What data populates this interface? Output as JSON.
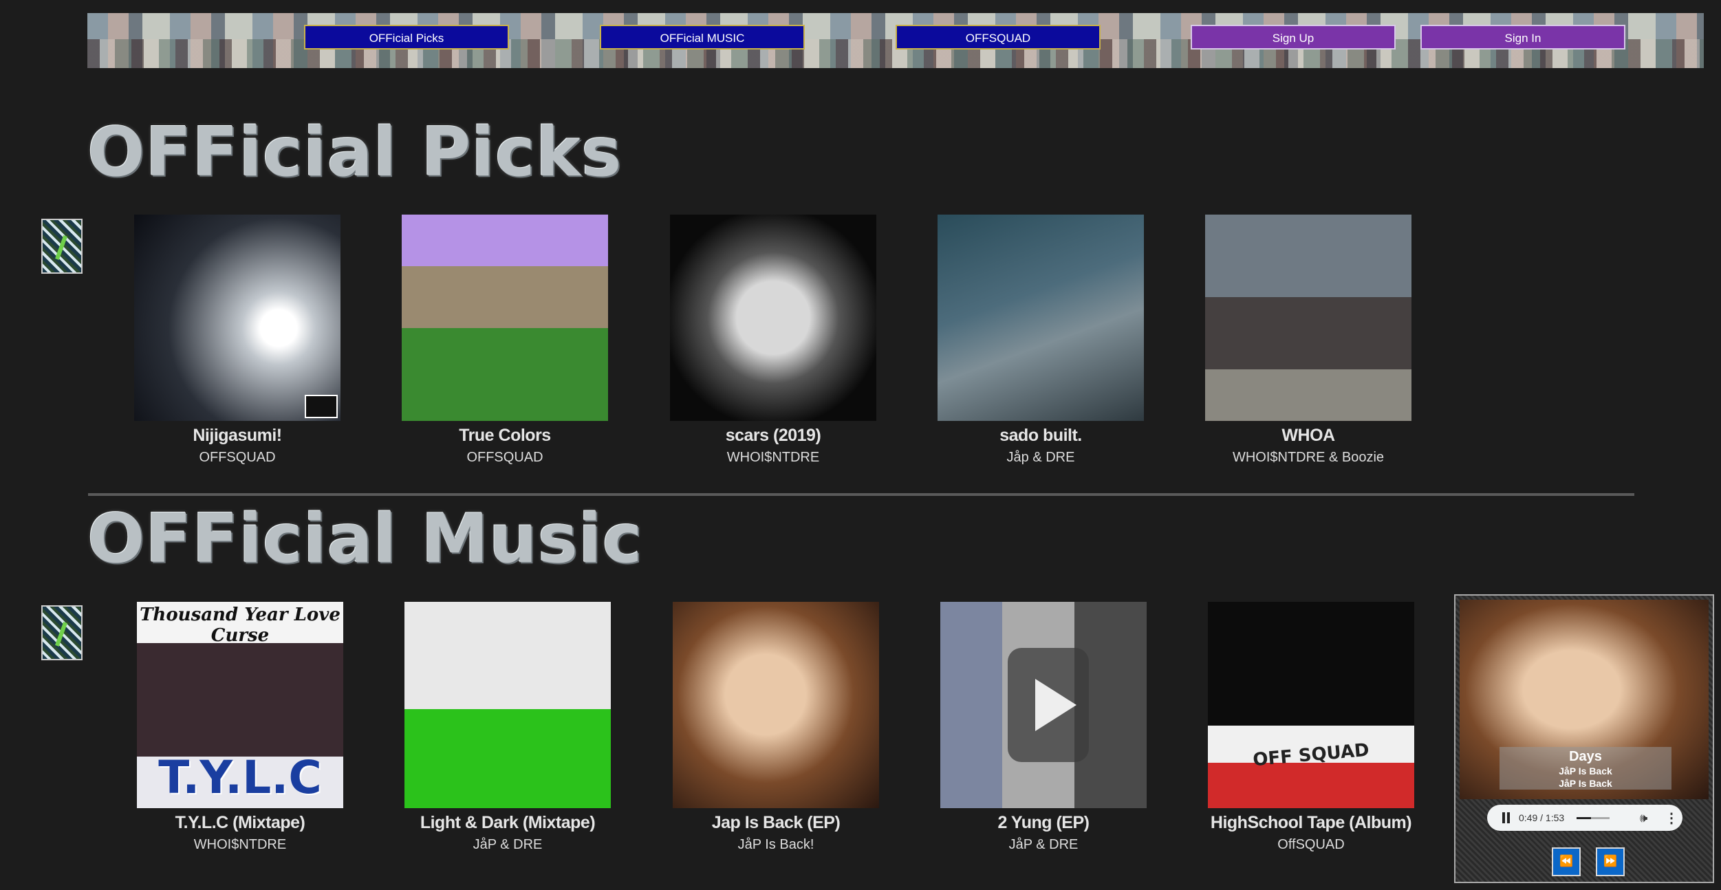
{
  "nav": {
    "items": [
      {
        "label": "OFFicial Picks",
        "style": "blue"
      },
      {
        "label": "OFFicial MUSIC",
        "style": "blue"
      },
      {
        "label": "OFFSQUAD",
        "style": "blue"
      },
      {
        "label": "Sign Up",
        "style": "purple"
      },
      {
        "label": "Sign In",
        "style": "purple"
      }
    ]
  },
  "picks": {
    "title": "OFFicial Picks",
    "items": [
      {
        "title": "Nijigasumi!",
        "artist": "OFFSQUAD"
      },
      {
        "title": "True Colors",
        "artist": "OFFSQUAD"
      },
      {
        "title": "scars (2019)",
        "artist": "WHOI$NTDRE"
      },
      {
        "title": "sado built.",
        "artist": "Jåp & DRE"
      },
      {
        "title": "WHOA",
        "artist": "WHOI$NTDRE & Boozie"
      }
    ]
  },
  "music": {
    "title": "OFFicial Music",
    "items": [
      {
        "title": "T.Y.L.C (Mixtape)",
        "artist": "WHOI$NTDRE",
        "art_text_top": "Thousand Year Love Curse",
        "art_text_bottom": "T.Y.L.C"
      },
      {
        "title": "Light & Dark (Mixtape)",
        "artist": "JåP & DRE"
      },
      {
        "title": "Jap Is Back (EP)",
        "artist": "JåP Is Back!"
      },
      {
        "title": "2 Yung (EP)",
        "artist": "JåP & DRE"
      },
      {
        "title": "HighSchool Tape (Album)",
        "artist": "OffSQUAD",
        "art_text": "OFF SQUAD"
      }
    ]
  },
  "player": {
    "track": "Days",
    "artist_line1": "JåP Is Back",
    "artist_line2": "JåP Is Back",
    "time": "0:49 / 1:53",
    "progress": 0.43,
    "prev_icon": "rewind-icon",
    "next_icon": "fast-forward-icon"
  },
  "colors": {
    "background": "#1c1c1c",
    "nav_blue": "#0b0a9c",
    "nav_purple": "#7a34a8",
    "player_button": "#0b67c8"
  }
}
